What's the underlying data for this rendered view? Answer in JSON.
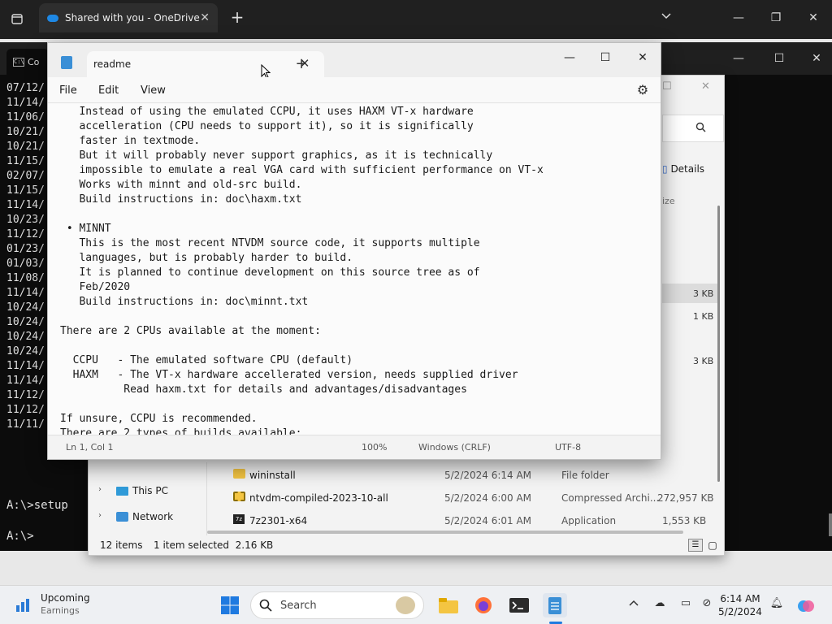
{
  "browser": {
    "tab_title": "Shared with you - OneDrive",
    "new_tab": "+",
    "tab_close": "✕"
  },
  "console": {
    "tab_label": "Co",
    "icon_text": "C:\\",
    "dates": [
      "07/12/",
      "11/14/",
      "11/06/",
      "10/21/",
      "10/21/",
      "11/15/",
      "02/07/",
      "11/15/",
      "11/14/",
      "10/23/",
      "11/12/",
      "01/23/",
      "01/03/",
      "11/08/",
      "11/14/",
      "10/24/",
      "10/24/",
      "10/24/",
      "10/24/",
      "11/14/",
      "11/14/",
      "11/12/",
      "11/12/",
      "11/11/"
    ],
    "prompt_setup": "A:\\>setup",
    "prompt_empty": "A:\\>"
  },
  "explorer": {
    "details_label": "Details",
    "column_size": "ize",
    "right_sizes": [
      "3 KB",
      "1 KB",
      "3 KB"
    ],
    "nav": [
      {
        "label": "This PC"
      },
      {
        "label": "Network"
      }
    ],
    "files": [
      {
        "name": "wininstall",
        "date": "5/2/2024 6:14 AM",
        "type": "File folder",
        "size": ""
      },
      {
        "name": "ntvdm-compiled-2023-10-all",
        "date": "5/2/2024 6:00 AM",
        "type": "Compressed Archi...",
        "size": "272,957 KB"
      },
      {
        "name": "7z2301-x64",
        "date": "5/2/2024 6:01 AM",
        "type": "Application",
        "size": "1,553 KB"
      }
    ],
    "status_count": "12 items",
    "status_selected": "1 item selected  2.16 KB"
  },
  "notepad": {
    "tab_title": "readme",
    "menu": [
      "File",
      "Edit",
      "View"
    ],
    "lines": [
      "   Instead of using the emulated CCPU, it uses HAXM VT-x hardware",
      "   accelleration (CPU needs to support it), so it is significally",
      "   faster in textmode.",
      "   But it will probably never support graphics, as it is technically",
      "   impossible to emulate a real VGA card with sufficient performance on VT-x",
      "   Works with minnt and old-src build.",
      "   Build instructions in: doc\\haxm.txt",
      "",
      " • MINNT",
      "   This is the most recent NTVDM source code, it supports multiple",
      "   languages, but is probably harder to build.",
      "   It is planned to continue development on this source tree as of",
      "   Feb/2020",
      "   Build instructions in: doc\\minnt.txt",
      "",
      "There are 2 CPUs available at the moment:",
      "",
      "  CCPU   - The emulated software CPU (default)",
      "  HAXM   - The VT-x hardware accellerated version, needs supplied driver",
      "          Read haxm.txt for details and advantages/disadvantages",
      "",
      "If unsure, CCPU is recommended.",
      "There are 2 types of builds available:"
    ],
    "status": {
      "position": "Ln 1, Col 1",
      "zoom": "100%",
      "line_ending": "Windows (CRLF)",
      "encoding": "UTF-8"
    }
  },
  "taskbar": {
    "widget_title": "Upcoming",
    "widget_subtitle": "Earnings",
    "search_placeholder": "Search",
    "time": "6:14 AM",
    "date": "5/2/2024"
  }
}
